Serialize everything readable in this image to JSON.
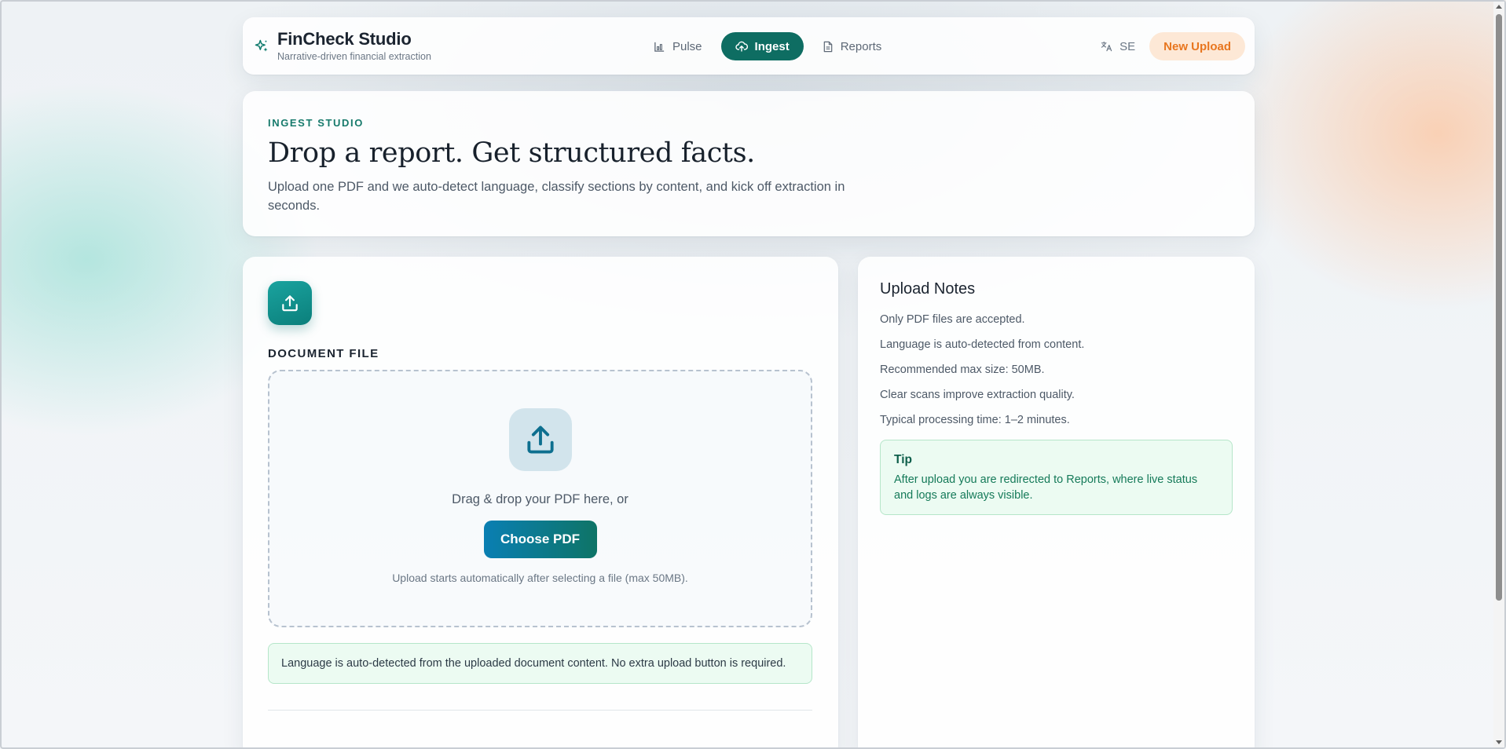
{
  "brand": {
    "name": "FinCheck Studio",
    "tagline": "Narrative-driven financial extraction",
    "icon": "sparkles-icon"
  },
  "nav": {
    "tabs": [
      {
        "label": "Pulse",
        "icon": "bar-chart-icon",
        "active": false
      },
      {
        "label": "Ingest",
        "icon": "cloud-upload-icon",
        "active": true
      },
      {
        "label": "Reports",
        "icon": "document-icon",
        "active": false
      }
    ],
    "language": {
      "label": "SE",
      "icon": "translate-icon"
    },
    "new_upload_label": "New Upload"
  },
  "hero": {
    "eyebrow": "INGEST STUDIO",
    "title": "Drop a report. Get structured facts.",
    "subtitle": "Upload one PDF and we auto-detect language, classify sections by content, and kick off extraction in seconds."
  },
  "upload": {
    "section_label": "DOCUMENT FILE",
    "drop_text": "Drag & drop your PDF here, or",
    "button_label": "Choose PDF",
    "hint": "Upload starts automatically after selecting a file (max 50MB).",
    "note": "Language is auto-detected from the uploaded document content. No extra upload button is required."
  },
  "notes": {
    "title": "Upload Notes",
    "items": [
      "Only PDF files are accepted.",
      "Language is auto-detected from content.",
      "Recommended max size: 50MB.",
      "Clear scans improve extraction quality.",
      "Typical processing time: 1–2 minutes."
    ],
    "tip": {
      "title": "Tip",
      "text": "After upload you are redirected to Reports, where live status and logs are always visible."
    }
  },
  "colors": {
    "brand_accent": "#0e6d62",
    "cta_orange": "#e8761f",
    "cta_orange_bg": "#fde8d6",
    "success_bg": "#ecfbf2",
    "success_border": "#b5e6c9"
  }
}
